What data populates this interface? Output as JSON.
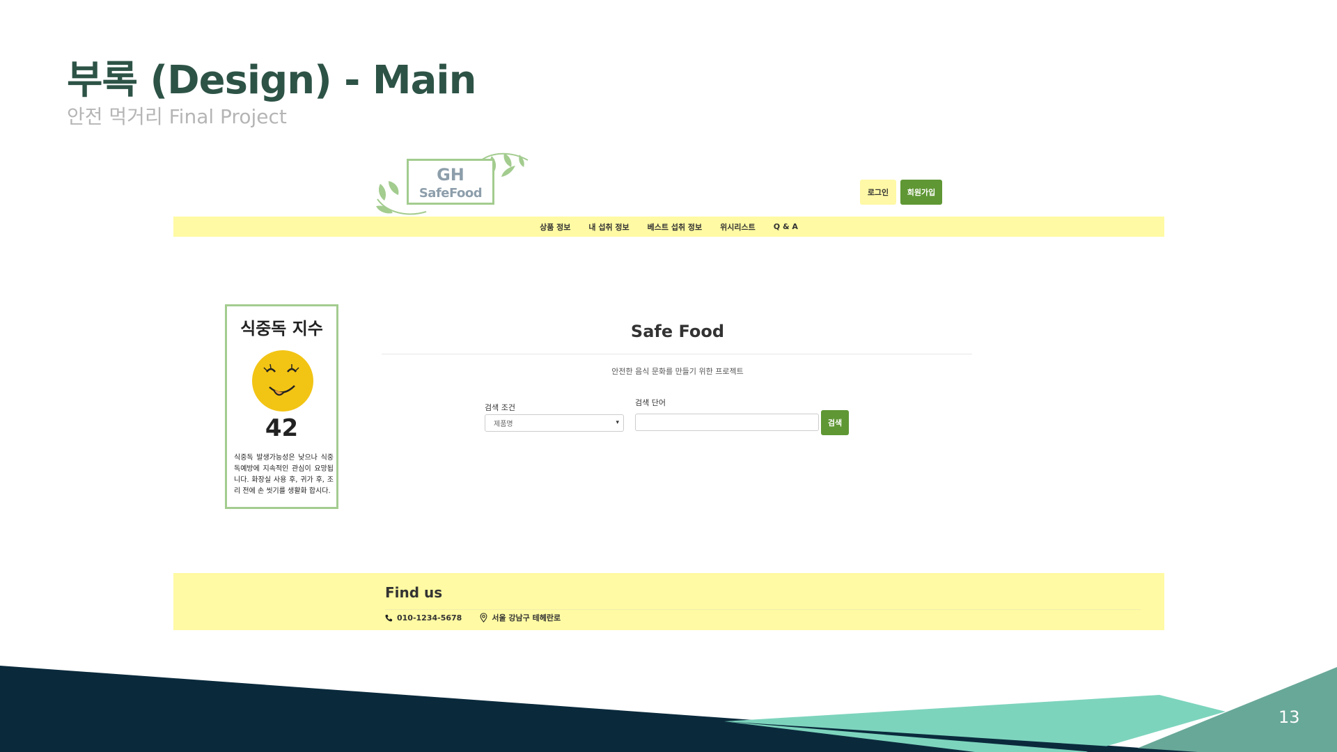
{
  "slide": {
    "title": "부록 (Design) - Main",
    "subtitle": "안전 먹거리 Final Project",
    "page_number": "13"
  },
  "site": {
    "logo": {
      "line1": "GH",
      "line2": "SafeFood"
    },
    "header": {
      "login_label": "로그인",
      "signup_label": "회원가입"
    },
    "nav": [
      "상품 정보",
      "내 섭취 정보",
      "베스트 섭취 정보",
      "위시리스트",
      "Q & A"
    ],
    "food_index": {
      "title": "식중독 지수",
      "value": "42",
      "description": "식중독 발생가능성은 낮으나 식중독예방에 지속적인 관심이 요망됩니다. 화장실 사용 후, 귀가 후, 조리 전에 손 씻기를 생활화 합시다."
    },
    "main": {
      "heading": "Safe Food",
      "subheading": "안전한 음식 문화를 만들기 위한 프로젝트",
      "search_condition_label": "검색 조건",
      "search_condition_value": "제품명",
      "search_term_label": "검색 단어",
      "search_term_value": "",
      "search_button": "검색"
    },
    "footer": {
      "title": "Find us",
      "phone": "010-1234-5678",
      "address": "서울 강남구 테헤란로"
    }
  },
  "colors": {
    "title": "#2d5346",
    "nav_bg": "#fffaa3",
    "green_button": "#5f9734",
    "card_border": "#a3cc8f",
    "deco_navy": "#0a2a3c",
    "deco_mint": "#7dd4bd",
    "deco_teal": "#68a898"
  },
  "icons": [
    "phone-icon",
    "location-pin-icon",
    "smiley-face-icon",
    "leaf-icon",
    "dropdown-arrow-icon"
  ]
}
